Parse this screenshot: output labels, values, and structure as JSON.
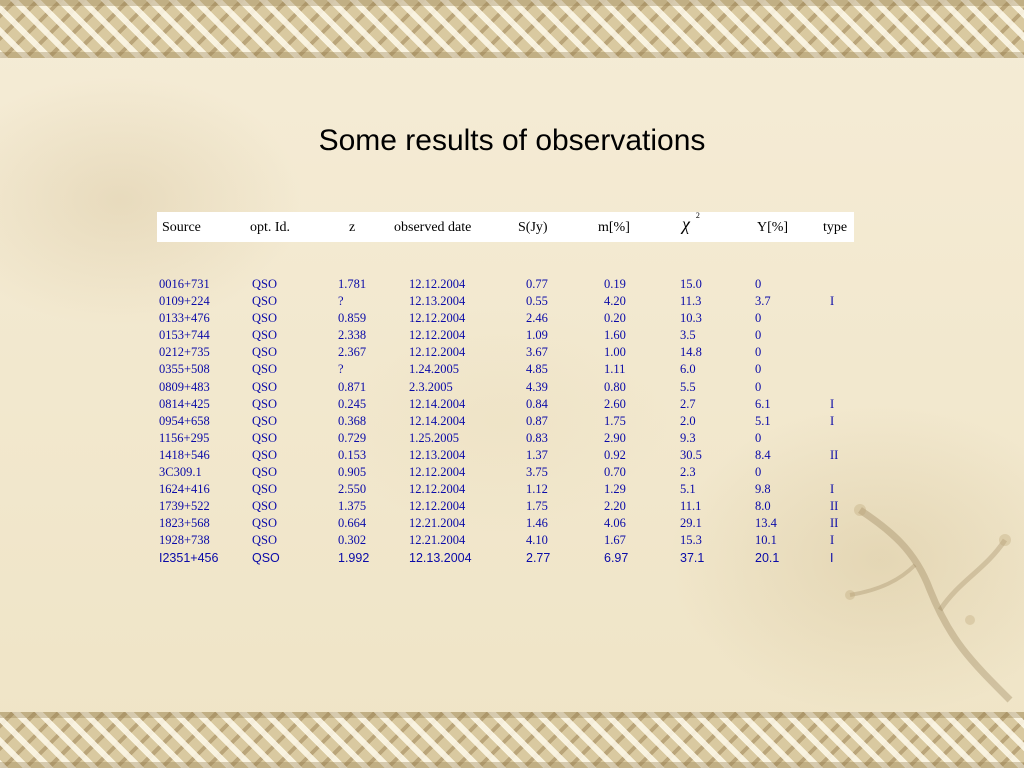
{
  "slide": {
    "title": "Some results of observations",
    "header": {
      "source": "Source",
      "opt_id": "opt. Id.",
      "z": "z",
      "observed_date": "observed date",
      "s_jy": "S(Jy)",
      "m_pct": "m[%]",
      "chi_symbol": "χ",
      "chi_sup": "2",
      "y_pct": "Y[%]",
      "type": "type"
    },
    "rows": [
      {
        "source": "0016+731",
        "opt": "QSO",
        "z": "1.781",
        "date": "12.12.2004",
        "s": "0.77",
        "m": "0.19",
        "chi2": "15.0",
        "y": "0",
        "type": ""
      },
      {
        "source": "0109+224",
        "opt": "QSO",
        "z": "?",
        "date": "12.13.2004",
        "s": "0.55",
        "m": "4.20",
        "chi2": "11.3",
        "y": "3.7",
        "type": "I"
      },
      {
        "source": "0133+476",
        "opt": "QSO",
        "z": "0.859",
        "date": "12.12.2004",
        "s": "2.46",
        "m": "0.20",
        "chi2": "10.3",
        "y": "0",
        "type": ""
      },
      {
        "source": "0153+744",
        "opt": "QSO",
        "z": "2.338",
        "date": "12.12.2004",
        "s": "1.09",
        "m": "1.60",
        "chi2": "3.5",
        "y": "0",
        "type": ""
      },
      {
        "source": "0212+735",
        "opt": "QSO",
        "z": "2.367",
        "date": "12.12.2004",
        "s": "3.67",
        "m": "1.00",
        "chi2": "14.8",
        "y": "0",
        "type": ""
      },
      {
        "source": "0355+508",
        "opt": "QSO",
        "z": "?",
        "date": "1.24.2005",
        "s": "4.85",
        "m": "1.11",
        "chi2": "6.0",
        "y": "0",
        "type": ""
      },
      {
        "source": "0809+483",
        "opt": "QSO",
        "z": "0.871",
        "date": "2.3.2005",
        "s": "4.39",
        "m": "0.80",
        "chi2": "5.5",
        "y": "0",
        "type": ""
      },
      {
        "source": "0814+425",
        "opt": "QSO",
        "z": "0.245",
        "date": "12.14.2004",
        "s": "0.84",
        "m": "2.60",
        "chi2": "2.7",
        "y": "6.1",
        "type": "I"
      },
      {
        "source": "0954+658",
        "opt": "QSO",
        "z": "0.368",
        "date": "12.14.2004",
        "s": "0.87",
        "m": "1.75",
        "chi2": "2.0",
        "y": "5.1",
        "type": "I"
      },
      {
        "source": "1156+295",
        "opt": "QSO",
        "z": "0.729",
        "date": "1.25.2005",
        "s": "0.83",
        "m": "2.90",
        "chi2": "9.3",
        "y": "0",
        "type": ""
      },
      {
        "source": "1418+546",
        "opt": "QSO",
        "z": "0.153",
        "date": "12.13.2004",
        "s": "1.37",
        "m": "0.92",
        "chi2": "30.5",
        "y": "8.4",
        "type": "II"
      },
      {
        "source": "3C309.1",
        "opt": "QSO",
        "z": "0.905",
        "date": "12.12.2004",
        "s": "3.75",
        "m": "0.70",
        "chi2": "2.3",
        "y": "0",
        "type": ""
      },
      {
        "source": "1624+416",
        "opt": "QSO",
        "z": "2.550",
        "date": "12.12.2004",
        "s": "1.12",
        "m": "1.29",
        "chi2": "5.1",
        "y": "9.8",
        "type": "I"
      },
      {
        "source": "1739+522",
        "opt": "QSO",
        "z": "1.375",
        "date": "12.12.2004",
        "s": "1.75",
        "m": "2.20",
        "chi2": "11.1",
        "y": "8.0",
        "type": "II"
      },
      {
        "source": "1823+568",
        "opt": "QSO",
        "z": "0.664",
        "date": "12.21.2004",
        "s": "1.46",
        "m": "4.06",
        "chi2": "29.1",
        "y": "13.4",
        "type": "II"
      },
      {
        "source": "1928+738",
        "opt": "QSO",
        "z": "0.302",
        "date": "12.21.2004",
        "s": "4.10",
        "m": "1.67",
        "chi2": "15.3",
        "y": "10.1",
        "type": "I"
      },
      {
        "source": "I2351+456",
        "opt": "QSO",
        "z": "1.992",
        "date": "12.13.2004",
        "s": "2.77",
        "m": "6.97",
        "chi2": "37.1",
        "y": "20.1",
        "type": "I"
      }
    ]
  }
}
